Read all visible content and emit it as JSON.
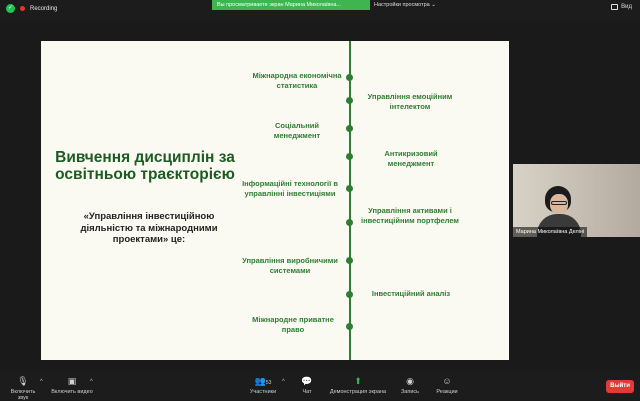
{
  "topbar": {
    "recording_label": "Recording",
    "share_banner": "Вы просматриваете экран Марина Миколаївна...",
    "view_options": "Настройки просмотра ⌄",
    "view_button": "Вид"
  },
  "slide": {
    "title": "Вивчення дисциплін за освітньою траєкторією",
    "subtitle": "«Управління інвестиційною діяльністю та міжнародними проектами» це:",
    "left_items": [
      "Міжнародна економічна статистика",
      "Соціальний менеджмент",
      "Інформаційні технології в управлінні інвестиціями",
      "Управління виробничими системами",
      "Міжнародне приватне право"
    ],
    "right_items": [
      "Управління емоційним інтелектом",
      "Антикризовий менеджмент",
      "Управління активами і інвестиційним портфелем",
      "Інвестиційний аналіз"
    ]
  },
  "video": {
    "participant_name": "Марина Миколаївна Деліні"
  },
  "toolbar": {
    "audio_label": "Включить звук",
    "video_label": "Включить видео",
    "participants_label": "Участники",
    "participants_count": "53",
    "chat_label": "Чат",
    "share_label": "Демонстрация экрана",
    "record_label": "Запись",
    "reactions_label": "Реакции",
    "leave_label": "Выйти"
  },
  "colors": {
    "slide_green": "#2e7d32",
    "banner_green": "#3fb54f",
    "leave_red": "#e03b35"
  }
}
